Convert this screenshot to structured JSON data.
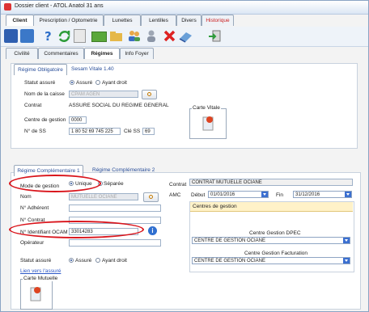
{
  "window": {
    "title": "Dossier client - ATOL Anatol 31 ans"
  },
  "top_tabs": [
    {
      "label": "Client"
    },
    {
      "label": "Prescription / Optometrie"
    },
    {
      "label": "Lunettes"
    },
    {
      "label": "Lentilles"
    },
    {
      "label": "Divers"
    },
    {
      "label": "Historique"
    }
  ],
  "sub_tabs": [
    {
      "label": "Civilité"
    },
    {
      "label": "Commentaires"
    },
    {
      "label": "Régimes"
    },
    {
      "label": "Info Foyer"
    }
  ],
  "regime_tabs": [
    {
      "label": "Régime Obligatoire"
    },
    {
      "label": "Sesam Vitale 1.40"
    }
  ],
  "obligatoire": {
    "statut_label": "Statut assuré",
    "opt_assure": "Assuré",
    "opt_ayant_droit": "Ayant droit",
    "caisse_label": "Nom de la caisse",
    "caisse_value": "CPAM AGEN",
    "contrat_label": "Contrat",
    "contrat_value": "ASSURE SOCIAL DU REGIME GENERAL",
    "centre_label": "Centre de gestion",
    "centre_value": "0000",
    "ss_label": "N° de SS",
    "ss_value": "1 80 52 69 745 225",
    "cle_label": "Clé SS",
    "cle_value": "69",
    "carte_vitale": "Carte Vitale"
  },
  "comp_tabs": [
    {
      "label": "Régime Complémentaire 1"
    },
    {
      "label": "Régime Complémentaire 2"
    }
  ],
  "complementaire": {
    "mode_label": "Mode de gestion",
    "opt_unique": "Unique",
    "opt_separee": "Séparée",
    "nom_label": "Nom",
    "nom_value": "MUTUELLE OCIANE",
    "adherent_label": "N° Adhérent",
    "contrat_num_label": "N° Contrat",
    "ocam_label": "N° Identifiant OCAM",
    "ocam_value": "33014283",
    "operateur_label": "Opérateur",
    "statut_label": "Statut assuré",
    "opt_assure": "Assuré",
    "opt_ayant_droit": "Ayant droit",
    "lien_label": "Lien vers l'assuré",
    "carte_mutuelle": "Carte Mutuelle",
    "contrat_label": "Contrat",
    "contrat_value": "CONTRAT MUTUELLE OCIANE",
    "amc_label": "AMC",
    "debut_label": "Début",
    "debut_value": "01/01/2016",
    "fin_label": "Fin",
    "fin_value": "31/12/2016",
    "centres_title": "Centres de gestion",
    "dpec_label": "Centre Gestion DPEC",
    "dpec_value": "CENTRE DE GESTION OCIANE",
    "factu_label": "Centre Gestion Facturation",
    "factu_value": "CENTRE DE GESTION OCIANE"
  },
  "colors": {
    "highlight": "#d9141b",
    "accent": "#3b6fd0"
  }
}
